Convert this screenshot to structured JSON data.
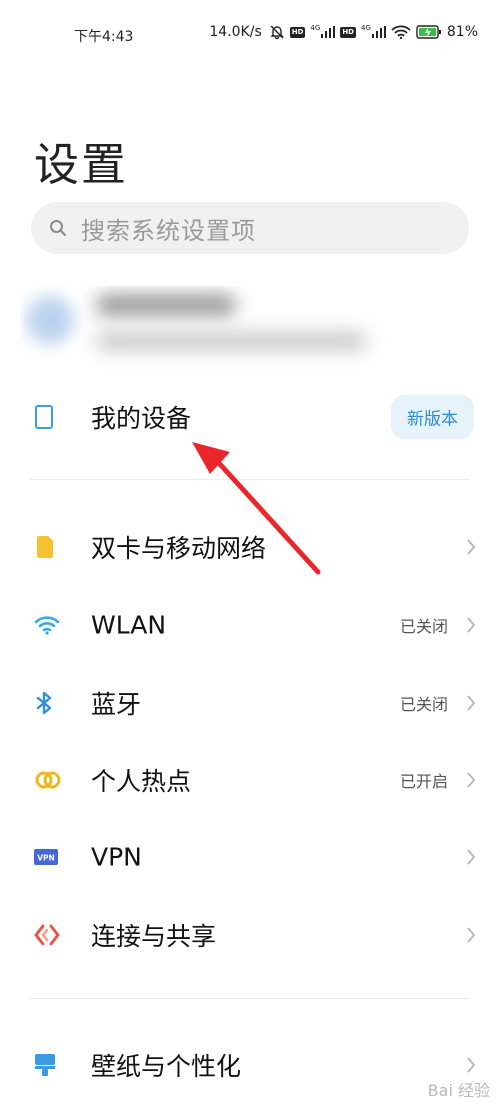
{
  "status_bar": {
    "time": "下午4:43",
    "net_speed": "14.0K/s",
    "hd_label": "HD",
    "net_type": "4G",
    "battery": "81%"
  },
  "page_title": "设置",
  "search": {
    "placeholder": "搜索系统设置项"
  },
  "my_device": {
    "label": "我的设备",
    "badge": "新版本",
    "icon": "phone-outline-icon"
  },
  "items": [
    {
      "label": "双卡与移动网络",
      "value": "",
      "icon": "sim-card-icon",
      "color": "#f5c12e"
    },
    {
      "label": "WLAN",
      "value": "已关闭",
      "icon": "wifi-icon",
      "color": "#3aa7e9"
    },
    {
      "label": "蓝牙",
      "value": "已关闭",
      "icon": "bluetooth-icon",
      "color": "#2f8fe0"
    },
    {
      "label": "个人热点",
      "value": "已开启",
      "icon": "hotspot-icon",
      "color": "#f2b61d"
    },
    {
      "label": "VPN",
      "value": "",
      "icon": "vpn-icon",
      "color": "#4467d8"
    },
    {
      "label": "连接与共享",
      "value": "",
      "icon": "share-icon",
      "color": "#e9574a"
    }
  ],
  "personalization": {
    "label": "壁纸与个性化",
    "icon": "wallpaper-icon",
    "color": "#3a9ae3"
  },
  "annotation_color": "#e8262b",
  "watermark": "Bai 经验"
}
